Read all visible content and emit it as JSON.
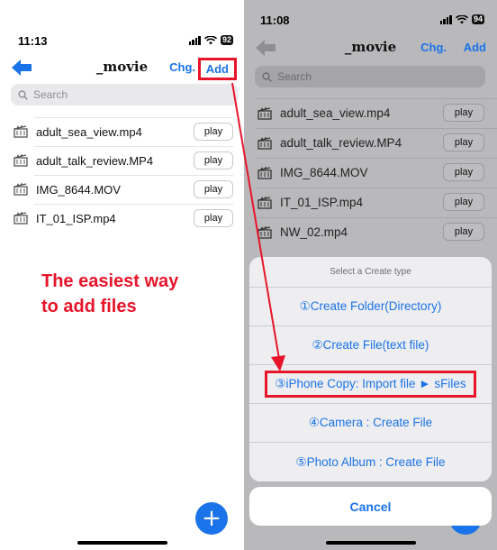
{
  "left": {
    "status": {
      "time": "11:13",
      "battery": "92"
    },
    "nav": {
      "title": "_movie",
      "chg": "Chg.",
      "add": "Add"
    },
    "search": {
      "placeholder": "Search"
    },
    "files": [
      {
        "name": "adult_sea_view.mp4",
        "action": "play"
      },
      {
        "name": "adult_talk_review.MP4",
        "action": "play"
      },
      {
        "name": "IMG_8644.MOV",
        "action": "play"
      },
      {
        "name": "IT_01_ISP.mp4",
        "action": "play"
      }
    ],
    "promo": {
      "line1": "The easiest way",
      "line2": "to add files"
    },
    "fab": "+"
  },
  "right": {
    "status": {
      "time": "11:08",
      "battery": "94"
    },
    "nav": {
      "title": "_movie",
      "chg": "Chg.",
      "add": "Add"
    },
    "search": {
      "placeholder": "Search"
    },
    "files": [
      {
        "name": "adult_sea_view.mp4",
        "action": "play"
      },
      {
        "name": "adult_talk_review.MP4",
        "action": "play"
      },
      {
        "name": "IMG_8644.MOV",
        "action": "play"
      },
      {
        "name": "IT_01_ISP.mp4",
        "action": "play"
      },
      {
        "name": "NW_02.mp4",
        "action": "play"
      }
    ],
    "sheet": {
      "title": "Select a Create type",
      "options": [
        "①Create Folder(Directory)",
        "②Create File(text file)",
        "③iPhone Copy: Import file ► sFiles",
        "④Camera : Create File",
        "⑤Photo Album : Create File"
      ],
      "cancel": "Cancel"
    }
  },
  "colors": {
    "accent": "#1a73e8",
    "highlight": "#e8142a"
  }
}
